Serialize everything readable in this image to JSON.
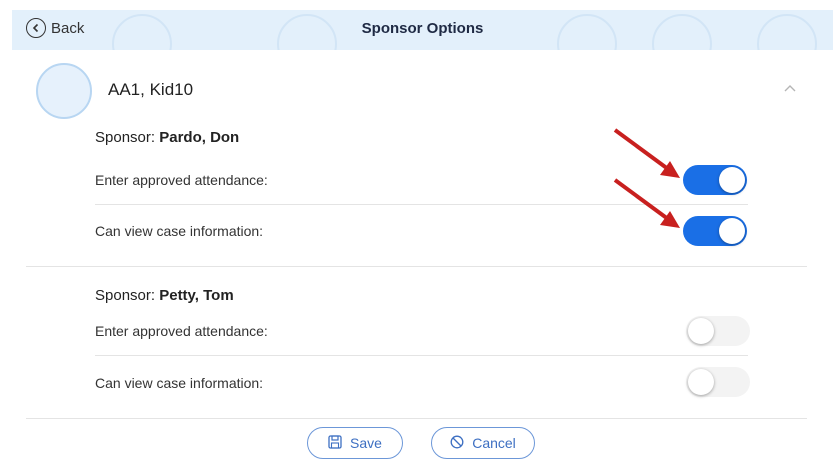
{
  "header": {
    "back_label": "Back",
    "title": "Sponsor Options"
  },
  "child": {
    "name": "AA1, Kid10",
    "expanded": true
  },
  "sponsors": [
    {
      "prefix": "Sponsor: ",
      "name": "Pardo, Don",
      "options": [
        {
          "label": "Enter approved attendance:",
          "enabled": true
        },
        {
          "label": "Can view case information:",
          "enabled": true
        }
      ]
    },
    {
      "prefix": "Sponsor: ",
      "name": "Petty, Tom",
      "options": [
        {
          "label": "Enter approved attendance:",
          "enabled": false
        },
        {
          "label": "Can view case information:",
          "enabled": false
        }
      ]
    }
  ],
  "actions": {
    "save_label": "Save",
    "cancel_label": "Cancel"
  },
  "colors": {
    "toggle_on": "#1a6fe6",
    "header_bg": "#e3f0fb",
    "arrow": "#c8201f",
    "button_border": "#6c97d8"
  },
  "icons": {
    "back": "back-circle-icon",
    "expand": "chevron-up-icon",
    "save": "floppy-disk-icon",
    "cancel": "cancel-circle-icon",
    "annotation": "red-arrow-icon"
  }
}
